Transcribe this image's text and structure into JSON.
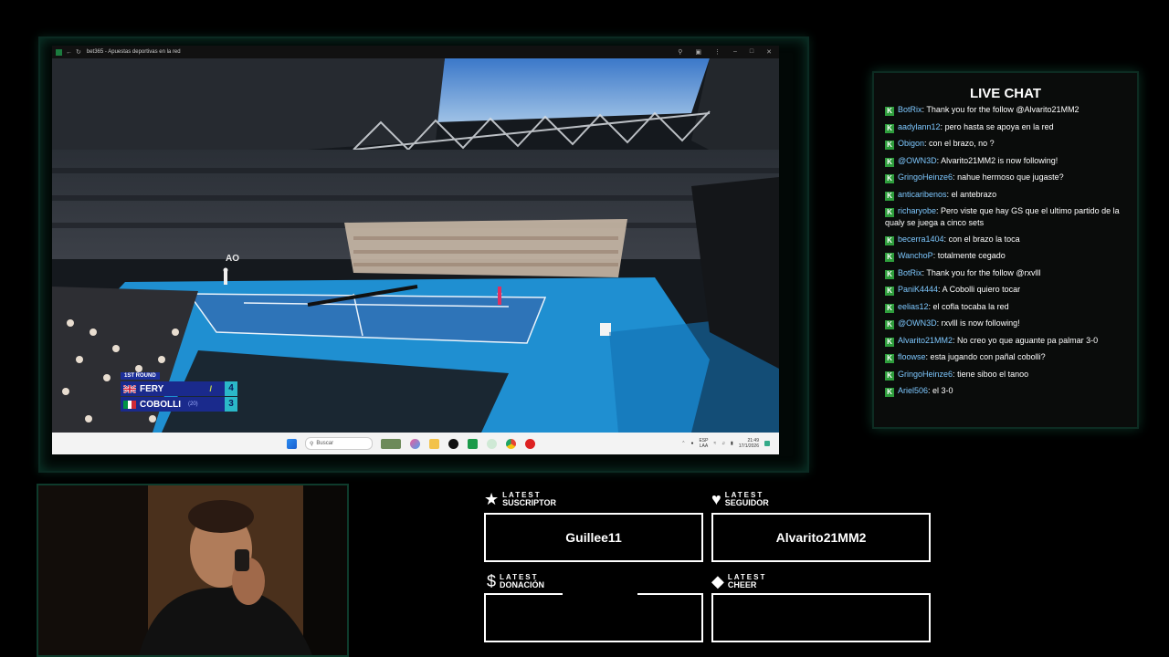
{
  "browser": {
    "tab_title": "bet365 - Apuestas deportivas en la red"
  },
  "taskbar": {
    "search_placeholder": "Buscar",
    "lang_top": "ESP",
    "lang_bottom": "LAA",
    "time": "21:49",
    "date": "17/1/2026"
  },
  "scoreboard": {
    "round": "1ST ROUND",
    "players": [
      {
        "name": "FERY",
        "seed": "",
        "score": "4"
      },
      {
        "name": "COBOLLI",
        "seed": "(20)",
        "score": "3"
      }
    ]
  },
  "chat": {
    "title": "LIVE CHAT",
    "messages": [
      {
        "user": "BotRix",
        "text": "Thank you for the follow @Alvarito21MM2"
      },
      {
        "user": "aadylann12",
        "text": "pero hasta se apoya en la red"
      },
      {
        "user": "Obigon",
        "text": "con el brazo, no ?"
      },
      {
        "user": "@OWN3D",
        "text": "Alvarito21MM2 is now following!"
      },
      {
        "user": "GringoHeinze6",
        "text": "nahue hermoso que jugaste?"
      },
      {
        "user": "anticaribenos",
        "text": "el antebrazo"
      },
      {
        "user": "richaryobe",
        "text": "Pero viste que hay GS que el ultimo partido de la qualy se juega a cinco sets"
      },
      {
        "user": "becerra1404",
        "text": "con el brazo la toca"
      },
      {
        "user": "WanchoP",
        "text": "totalmente cegado"
      },
      {
        "user": "BotRix",
        "text": "Thank you for the follow @rxvlll"
      },
      {
        "user": "PaniK4444",
        "text": "A Cobolli quiero tocar"
      },
      {
        "user": "eelias12",
        "text": "el cofla tocaba la red"
      },
      {
        "user": "@OWN3D",
        "text": "rxvlll is now following!"
      },
      {
        "user": "Alvarito21MM2",
        "text": "No creo yo que aguante pa palmar 3-0"
      },
      {
        "user": "floowse",
        "text": "esta jugando con pañal cobolli?"
      },
      {
        "user": "GringoHeinze6",
        "text": "tiene siboo el tanoo"
      },
      {
        "user": "Ariel506",
        "text": "el 3-0"
      }
    ]
  },
  "stats": {
    "latest_word": "LATEST",
    "subscriber": {
      "label": "SUSCRIPTOR",
      "value": "Guillee11"
    },
    "follower": {
      "label": "SEGUIDOR",
      "value": "Alvarito21MM2"
    },
    "donation": {
      "label": "DONACIÓN",
      "value": ""
    },
    "cheer": {
      "label": "CHEER",
      "value": ""
    }
  },
  "colors": {
    "accent_green": "#0e3b2c",
    "chat_user": "#7ec8ff",
    "badge": "#2e9d3c",
    "court_blue": "#1f8fd1"
  }
}
